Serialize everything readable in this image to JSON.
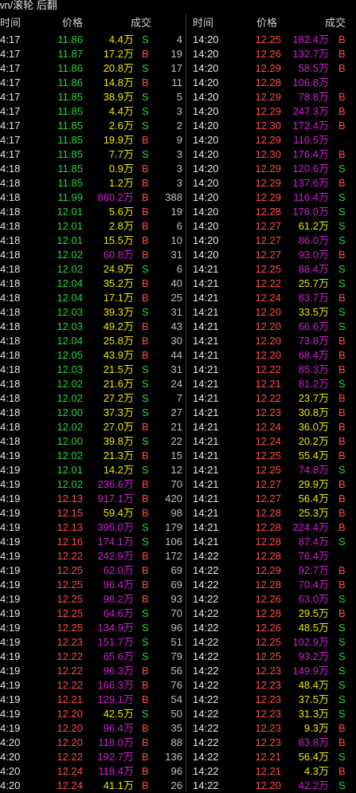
{
  "title": "wn/滚轮 后翻",
  "headers": {
    "time": "时间",
    "price": "价格",
    "volume": "成交"
  },
  "left": [
    {
      "t": "4:17",
      "p": "11.86",
      "a": "4.4万",
      "s": "S",
      "c": "4",
      "pc": "down",
      "ac": "Y"
    },
    {
      "t": "4:17",
      "p": "11.87",
      "a": "17.2万",
      "s": "B",
      "c": "19",
      "pc": "down",
      "ac": "Y"
    },
    {
      "t": "4:17",
      "p": "11.86",
      "a": "20.8万",
      "s": "S",
      "c": "17",
      "pc": "down",
      "ac": "Y"
    },
    {
      "t": "4:17",
      "p": "11.86",
      "a": "14.8万",
      "s": "B",
      "c": "11",
      "pc": "down",
      "ac": "Y"
    },
    {
      "t": "4:17",
      "p": "11.85",
      "a": "38.9万",
      "s": "S",
      "c": "5",
      "pc": "down",
      "ac": "Y"
    },
    {
      "t": "4:17",
      "p": "11.85",
      "a": "4.4万",
      "s": "S",
      "c": "3",
      "pc": "down",
      "ac": "Y"
    },
    {
      "t": "4:17",
      "p": "11.85",
      "a": "2.6万",
      "s": "S",
      "c": "2",
      "pc": "down",
      "ac": "Y"
    },
    {
      "t": "4:17",
      "p": "11.85",
      "a": "19.9万",
      "s": "B",
      "c": "9",
      "pc": "down",
      "ac": "Y"
    },
    {
      "t": "4:17",
      "p": "11.85",
      "a": "7.7万",
      "s": "S",
      "c": "3",
      "pc": "down",
      "ac": "Y"
    },
    {
      "t": "4:18",
      "p": "11.85",
      "a": "0.9万",
      "s": "B",
      "c": "3",
      "pc": "down",
      "ac": "Y"
    },
    {
      "t": "4:18",
      "p": "11.85",
      "a": "1.2万",
      "s": "B",
      "c": "3",
      "pc": "down",
      "ac": "Y"
    },
    {
      "t": "4:18",
      "p": "11.99",
      "a": "860.2万",
      "s": "B",
      "c": "388",
      "pc": "down",
      "ac": "M"
    },
    {
      "t": "4:18",
      "p": "12.01",
      "a": "5.6万",
      "s": "B",
      "c": "19",
      "pc": "down",
      "ac": "Y"
    },
    {
      "t": "4:18",
      "p": "12.01",
      "a": "2.8万",
      "s": "B",
      "c": "6",
      "pc": "down",
      "ac": "Y"
    },
    {
      "t": "4:18",
      "p": "12.01",
      "a": "15.5万",
      "s": "B",
      "c": "10",
      "pc": "down",
      "ac": "Y"
    },
    {
      "t": "4:18",
      "p": "12.02",
      "a": "60.8万",
      "s": "B",
      "c": "31",
      "pc": "down",
      "ac": "M"
    },
    {
      "t": "4:18",
      "p": "12.02",
      "a": "24.9万",
      "s": "S",
      "c": "6",
      "pc": "down",
      "ac": "Y"
    },
    {
      "t": "4:18",
      "p": "12.04",
      "a": "35.2万",
      "s": "B",
      "c": "40",
      "pc": "down",
      "ac": "Y"
    },
    {
      "t": "4:18",
      "p": "12.04",
      "a": "17.1万",
      "s": "B",
      "c": "25",
      "pc": "down",
      "ac": "Y"
    },
    {
      "t": "4:18",
      "p": "12.03",
      "a": "39.3万",
      "s": "S",
      "c": "31",
      "pc": "down",
      "ac": "Y"
    },
    {
      "t": "4:18",
      "p": "12.03",
      "a": "49.2万",
      "s": "B",
      "c": "43",
      "pc": "down",
      "ac": "Y"
    },
    {
      "t": "4:18",
      "p": "12.04",
      "a": "25.8万",
      "s": "B",
      "c": "30",
      "pc": "down",
      "ac": "Y"
    },
    {
      "t": "4:18",
      "p": "12.05",
      "a": "43.9万",
      "s": "B",
      "c": "44",
      "pc": "down",
      "ac": "Y"
    },
    {
      "t": "4:18",
      "p": "12.03",
      "a": "21.5万",
      "s": "S",
      "c": "31",
      "pc": "down",
      "ac": "Y"
    },
    {
      "t": "4:18",
      "p": "12.02",
      "a": "21.6万",
      "s": "S",
      "c": "24",
      "pc": "down",
      "ac": "Y"
    },
    {
      "t": "4:18",
      "p": "12.02",
      "a": "27.2万",
      "s": "S",
      "c": "7",
      "pc": "down",
      "ac": "Y"
    },
    {
      "t": "4:18",
      "p": "12.00",
      "a": "37.3万",
      "s": "S",
      "c": "27",
      "pc": "down",
      "ac": "Y"
    },
    {
      "t": "4:18",
      "p": "12.02",
      "a": "27.0万",
      "s": "B",
      "c": "21",
      "pc": "down",
      "ac": "Y"
    },
    {
      "t": "4:18",
      "p": "12.00",
      "a": "39.8万",
      "s": "S",
      "c": "22",
      "pc": "down",
      "ac": "Y"
    },
    {
      "t": "4:19",
      "p": "12.02",
      "a": "21.3万",
      "s": "B",
      "c": "15",
      "pc": "down",
      "ac": "Y"
    },
    {
      "t": "4:19",
      "p": "12.01",
      "a": "14.2万",
      "s": "S",
      "c": "12",
      "pc": "down",
      "ac": "Y"
    },
    {
      "t": "4:19",
      "p": "12.02",
      "a": "236.6万",
      "s": "B",
      "c": "70",
      "pc": "down",
      "ac": "M"
    },
    {
      "t": "4:19",
      "p": "12.13",
      "a": "917.1万",
      "s": "B",
      "c": "420",
      "pc": "up",
      "ac": "M"
    },
    {
      "t": "4:19",
      "p": "12.15",
      "a": "59.4万",
      "s": "B",
      "c": "98",
      "pc": "up",
      "ac": "Y"
    },
    {
      "t": "4:19",
      "p": "12.13",
      "a": "395.0万",
      "s": "S",
      "c": "179",
      "pc": "up",
      "ac": "M"
    },
    {
      "t": "4:19",
      "p": "12.16",
      "a": "174.1万",
      "s": "S",
      "c": "106",
      "pc": "up",
      "ac": "M"
    },
    {
      "t": "4:19",
      "p": "12.22",
      "a": "242.9万",
      "s": "B",
      "c": "172",
      "pc": "up",
      "ac": "M"
    },
    {
      "t": "4:19",
      "p": "12.25",
      "a": "62.0万",
      "s": "B",
      "c": "69",
      "pc": "up",
      "ac": "M"
    },
    {
      "t": "4:19",
      "p": "12.25",
      "a": "96.4万",
      "s": "B",
      "c": "69",
      "pc": "up",
      "ac": "M"
    },
    {
      "t": "4:19",
      "p": "12.25",
      "a": "98.2万",
      "s": "B",
      "c": "93",
      "pc": "up",
      "ac": "M"
    },
    {
      "t": "4:19",
      "p": "12.25",
      "a": "64.6万",
      "s": "S",
      "c": "70",
      "pc": "up",
      "ac": "M"
    },
    {
      "t": "4:19",
      "p": "12.25",
      "a": "134.9万",
      "s": "S",
      "c": "96",
      "pc": "up",
      "ac": "M"
    },
    {
      "t": "4:19",
      "p": "12.23",
      "a": "151.7万",
      "s": "S",
      "c": "51",
      "pc": "up",
      "ac": "M"
    },
    {
      "t": "4:19",
      "p": "12.22",
      "a": "65.6万",
      "s": "S",
      "c": "79",
      "pc": "up",
      "ac": "M"
    },
    {
      "t": "4:19",
      "p": "12.22",
      "a": "96.3万",
      "s": "B",
      "c": "56",
      "pc": "up",
      "ac": "M"
    },
    {
      "t": "4:19",
      "p": "12.22",
      "a": "166.3万",
      "s": "B",
      "c": "76",
      "pc": "up",
      "ac": "M"
    },
    {
      "t": "4:19",
      "p": "12.21",
      "a": "129.1万",
      "s": "B",
      "c": "54",
      "pc": "up",
      "ac": "M"
    },
    {
      "t": "4:19",
      "p": "12.20",
      "a": "42.5万",
      "s": "S",
      "c": "50",
      "pc": "up",
      "ac": "Y"
    },
    {
      "t": "4:19",
      "p": "12.20",
      "a": "96.4万",
      "s": "B",
      "c": "35",
      "pc": "up",
      "ac": "M"
    },
    {
      "t": "4:20",
      "p": "12.20",
      "a": "118.0万",
      "s": "B",
      "c": "88",
      "pc": "up",
      "ac": "M"
    },
    {
      "t": "4:20",
      "p": "12.22",
      "a": "192.7万",
      "s": "B",
      "c": "136",
      "pc": "up",
      "ac": "M"
    },
    {
      "t": "4:20",
      "p": "12.24",
      "a": "118.4万",
      "s": "B",
      "c": "96",
      "pc": "up",
      "ac": "M"
    },
    {
      "t": "4:20",
      "p": "12.24",
      "a": "41.1万",
      "s": "B",
      "c": "26",
      "pc": "up",
      "ac": "Y"
    }
  ],
  "right": [
    {
      "t": "14:20",
      "p": "12.25",
      "a": "182.4万",
      "s": "B",
      "ac": "M"
    },
    {
      "t": "14:20",
      "p": "12.26",
      "a": "132.7万",
      "s": "B",
      "ac": "M"
    },
    {
      "t": "14:20",
      "p": "12.29",
      "a": "58.5万",
      "s": "B",
      "ac": "M"
    },
    {
      "t": "14:20",
      "p": "12.28",
      "a": "106.8万",
      "s": "",
      "ac": "M"
    },
    {
      "t": "14:20",
      "p": "12.29",
      "a": "78.8万",
      "s": "B",
      "ac": "M"
    },
    {
      "t": "14:20",
      "p": "12.29",
      "a": "247.3万",
      "s": "B",
      "ac": "M"
    },
    {
      "t": "14:20",
      "p": "12.30",
      "a": "172.4万",
      "s": "B",
      "ac": "M"
    },
    {
      "t": "14:20",
      "p": "12.29",
      "a": "110.5万",
      "s": "",
      "ac": "M"
    },
    {
      "t": "14:20",
      "p": "12.30",
      "a": "176.4万",
      "s": "B",
      "ac": "M"
    },
    {
      "t": "14:20",
      "p": "12.29",
      "a": "120.6万",
      "s": "S",
      "ac": "M"
    },
    {
      "t": "14:20",
      "p": "12.29",
      "a": "137.6万",
      "s": "B",
      "ac": "M"
    },
    {
      "t": "14:20",
      "p": "12.29",
      "a": "116.4万",
      "s": "S",
      "ac": "M"
    },
    {
      "t": "14:20",
      "p": "12.28",
      "a": "176.0万",
      "s": "S",
      "ac": "M"
    },
    {
      "t": "14:20",
      "p": "12.27",
      "a": "61.2万",
      "s": "S",
      "ac": "Y"
    },
    {
      "t": "14:20",
      "p": "12.27",
      "a": "86.0万",
      "s": "S",
      "ac": "M"
    },
    {
      "t": "14:20",
      "p": "12.27",
      "a": "93.0万",
      "s": "B",
      "ac": "M"
    },
    {
      "t": "14:21",
      "p": "12.25",
      "a": "88.4万",
      "s": "S",
      "ac": "M"
    },
    {
      "t": "14:21",
      "p": "12.22",
      "a": "25.7万",
      "s": "S",
      "ac": "Y"
    },
    {
      "t": "14:21",
      "p": "12.24",
      "a": "83.7万",
      "s": "B",
      "ac": "M"
    },
    {
      "t": "14:21",
      "p": "12.20",
      "a": "33.5万",
      "s": "S",
      "ac": "Y"
    },
    {
      "t": "14:21",
      "p": "12.20",
      "a": "66.6万",
      "s": "S",
      "ac": "M"
    },
    {
      "t": "14:21",
      "p": "12.20",
      "a": "73.8万",
      "s": "B",
      "ac": "M"
    },
    {
      "t": "14:21",
      "p": "12.20",
      "a": "68.4万",
      "s": "B",
      "ac": "M"
    },
    {
      "t": "14:21",
      "p": "12.22",
      "a": "85.3万",
      "s": "B",
      "ac": "M"
    },
    {
      "t": "14:21",
      "p": "12.21",
      "a": "81.2万",
      "s": "S",
      "ac": "M"
    },
    {
      "t": "14:21",
      "p": "12.22",
      "a": "23.7万",
      "s": "B",
      "ac": "Y"
    },
    {
      "t": "14:21",
      "p": "12.23",
      "a": "30.8万",
      "s": "B",
      "ac": "Y"
    },
    {
      "t": "14:21",
      "p": "12.24",
      "a": "36.0万",
      "s": "B",
      "ac": "Y"
    },
    {
      "t": "14:21",
      "p": "12.24",
      "a": "20.2万",
      "s": "B",
      "ac": "Y"
    },
    {
      "t": "14:21",
      "p": "12.25",
      "a": "55.4万",
      "s": "B",
      "ac": "Y"
    },
    {
      "t": "14:21",
      "p": "12.25",
      "a": "74.8万",
      "s": "S",
      "ac": "M"
    },
    {
      "t": "14:21",
      "p": "12.27",
      "a": "29.9万",
      "s": "B",
      "ac": "Y"
    },
    {
      "t": "14:21",
      "p": "12.27",
      "a": "56.4万",
      "s": "B",
      "ac": "Y"
    },
    {
      "t": "14:21",
      "p": "12.28",
      "a": "25.3万",
      "s": "B",
      "ac": "Y"
    },
    {
      "t": "14:21",
      "p": "12.28",
      "a": "224.4万",
      "s": "B",
      "ac": "M"
    },
    {
      "t": "14:21",
      "p": "12.28",
      "a": "87.4万",
      "s": "S",
      "ac": "M"
    },
    {
      "t": "14:22",
      "p": "12.28",
      "a": "76.4万",
      "s": "",
      "ac": "M"
    },
    {
      "t": "14:22",
      "p": "12.29",
      "a": "92.7万",
      "s": "B",
      "ac": "M"
    },
    {
      "t": "14:22",
      "p": "12.28",
      "a": "70.4万",
      "s": "B",
      "ac": "M"
    },
    {
      "t": "14:22",
      "p": "12.26",
      "a": "63.0万",
      "s": "S",
      "ac": "M"
    },
    {
      "t": "14:22",
      "p": "12.28",
      "a": "29.5万",
      "s": "B",
      "ac": "Y"
    },
    {
      "t": "14:22",
      "p": "12.26",
      "a": "48.5万",
      "s": "S",
      "ac": "Y"
    },
    {
      "t": "14:22",
      "p": "12.25",
      "a": "102.9万",
      "s": "S",
      "ac": "M"
    },
    {
      "t": "14:22",
      "p": "12.25",
      "a": "93.2万",
      "s": "S",
      "ac": "M"
    },
    {
      "t": "14:22",
      "p": "12.23",
      "a": "149.9万",
      "s": "S",
      "ac": "M"
    },
    {
      "t": "14:22",
      "p": "12.23",
      "a": "48.4万",
      "s": "S",
      "ac": "Y"
    },
    {
      "t": "14:22",
      "p": "12.23",
      "a": "37.5万",
      "s": "S",
      "ac": "Y"
    },
    {
      "t": "14:22",
      "p": "12.23",
      "a": "31.3万",
      "s": "S",
      "ac": "Y"
    },
    {
      "t": "14:22",
      "p": "12.23",
      "a": "9.3万",
      "s": "B",
      "ac": "Y"
    },
    {
      "t": "14:22",
      "p": "12.23",
      "a": "83.8万",
      "s": "B",
      "ac": "M"
    },
    {
      "t": "14:22",
      "p": "12.21",
      "a": "56.4万",
      "s": "S",
      "ac": "Y"
    },
    {
      "t": "14:22",
      "p": "12.21",
      "a": "4.3万",
      "s": "B",
      "ac": "Y"
    },
    {
      "t": "14:22",
      "p": "12.20",
      "a": "42.2万",
      "s": "S",
      "ac": "M"
    }
  ]
}
